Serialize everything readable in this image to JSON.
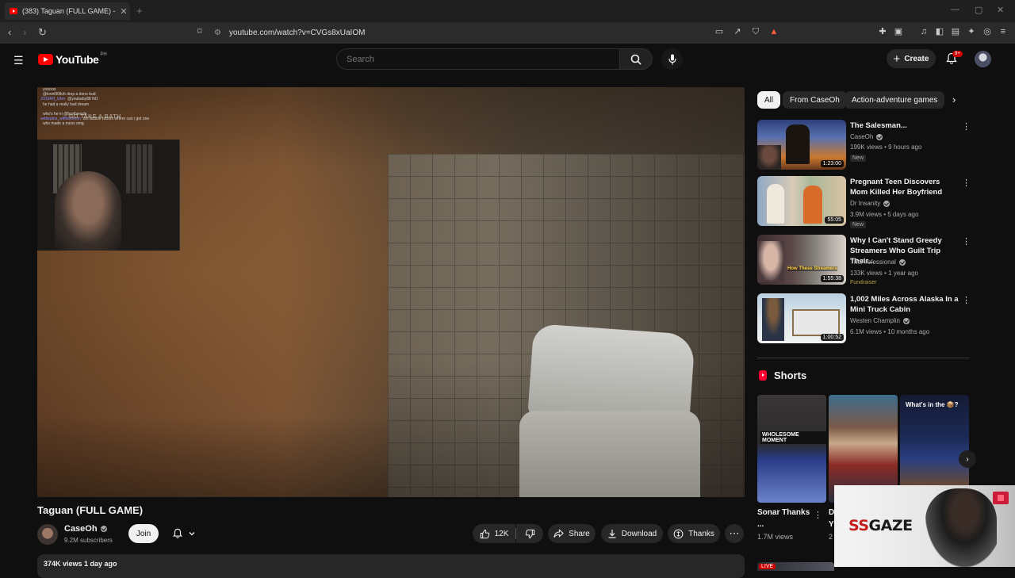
{
  "browser": {
    "tab_title": "(383) Taguan (FULL GAME) - You",
    "tab_close": "✕",
    "new_tab": "+",
    "url": "youtube.com/watch?v=CVGs8xUaIOM"
  },
  "youtube": {
    "logo_text": "YouTube",
    "country_code": "PH",
    "search_placeholder": "Search",
    "create_label": "Create",
    "notifications_badge": "9+"
  },
  "video": {
    "title": "Taguan (FULL GAME)",
    "overlay_text": "GO TAKE A BATH",
    "chat": [
      {
        "name": "",
        "msg": "yooooo"
      },
      {
        "name": "",
        "msg": "@lovel90lloh drop a dono bud"
      },
      {
        "name": "JOSIAH_Ukm",
        "msg": "@youbaby88 NO"
      },
      {
        "name": "",
        "msg": "he had a really bad dream"
      },
      {
        "name": "",
        "msg": ""
      },
      {
        "name": "",
        "msg": "who's he in @brotherede"
      },
      {
        "name": "sebleptos_wifflebottom",
        "msg": "oni dookie broom where can i get one"
      },
      {
        "name": "",
        "msg": "who made a mess omg"
      }
    ],
    "channel": {
      "name": "CaseOh",
      "subscribers": "9.2M subscribers",
      "join_label": "Join"
    },
    "actions": {
      "likes": "12K",
      "share": "Share",
      "download": "Download",
      "thanks": "Thanks"
    },
    "views_line": "374K views  1 day ago"
  },
  "sidebar": {
    "chips": [
      {
        "label": "All",
        "active": true
      },
      {
        "label": "From CaseOh",
        "active": false
      },
      {
        "label": "Action-adventure games",
        "active": false
      }
    ],
    "recommendations": [
      {
        "title": "The Salesman...",
        "channel": "CaseOh",
        "meta": "199K views • 9 hours ago",
        "badge": "New",
        "duration": "1:23:00"
      },
      {
        "title": "Pregnant Teen Discovers Mom Killed Her Boyfriend",
        "channel": "Dr Insanity",
        "meta": "3.9M views • 5 days ago",
        "badge": "New",
        "duration": "55:05"
      },
      {
        "title": "Why I Can't Stand Greedy Streamers Who Guilt Trip Their...",
        "channel": "TheProfessional",
        "meta": "133K views • 1 year ago",
        "badge": "Fundraiser",
        "duration": "1:55:38"
      },
      {
        "title": "1,002 Miles Across Alaska In a Mini Truck Cabin",
        "channel": "Westen Champlin",
        "meta": "6.1M views • 10 months ago",
        "badge": "",
        "duration": "1:00:52"
      }
    ],
    "shorts": {
      "heading": "Shorts",
      "items": [
        {
          "overlay": "WHOLESOME MOMENT"
        },
        {
          "overlay": ""
        },
        {
          "overlay": "What's in the 📦?"
        }
      ],
      "first_title": "Sonar Thanks ...",
      "first_views": "1.7M views",
      "second_title_clip": "D Y",
      "second_views_clip": "2"
    },
    "live_label": "LIVE"
  },
  "ad": {
    "brand_ss": "SS",
    "brand_rest": "GAZE"
  }
}
